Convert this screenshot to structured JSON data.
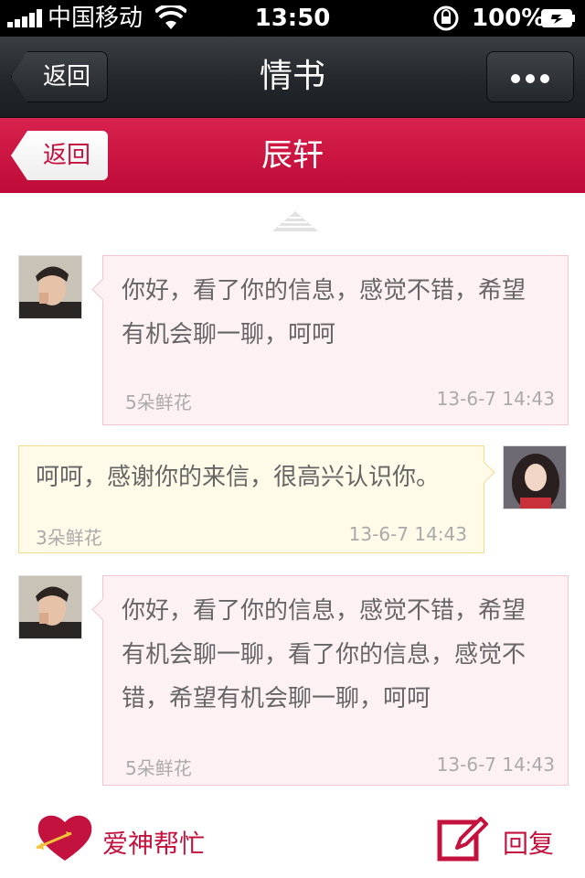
{
  "status_bar": {
    "carrier": "中国移动",
    "time": "13:50",
    "battery": "100%"
  },
  "navbar": {
    "back_label": "返回",
    "title": "情书",
    "more_icon": "ellipsis-icon"
  },
  "subbar": {
    "back_label": "返回",
    "title": "辰轩"
  },
  "messages": [
    {
      "side": "left",
      "text": "你好，看了你的信息，感觉不错，希望有机会聊一聊，呵呵",
      "lines": [
        "你好，看了你的信息，感觉不错，希望",
        "有机会聊一聊，呵呵"
      ],
      "flowers": "5朵鲜花",
      "time": "13-6-7 14:43"
    },
    {
      "side": "right",
      "text": "呵呵，感谢你的来信，很高兴认识你。",
      "lines": [
        "呵呵，感谢你的来信，很高兴认识你。"
      ],
      "flowers": "3朵鲜花",
      "time": "13-6-7 14:43"
    },
    {
      "side": "left",
      "text": "你好，看了你的信息，感觉不错，希望有机会聊一聊，看了你的信息，感觉不错，希望有机会聊一聊，呵呵",
      "lines": [
        "你好，看了你的信息，感觉不错，希望",
        "有机会聊一聊，看了你的信息，感觉不",
        "错，希望有机会聊一聊，呵呵"
      ],
      "flowers": "5朵鲜花",
      "time": "13-6-7 14:43"
    }
  ],
  "footer": {
    "cupid_label": "爱神帮忙",
    "reply_label": "回复"
  },
  "colors": {
    "accent": "#c4123e",
    "pink_bubble": "#fdf1f3",
    "yellow_bubble": "#fffbe8"
  }
}
